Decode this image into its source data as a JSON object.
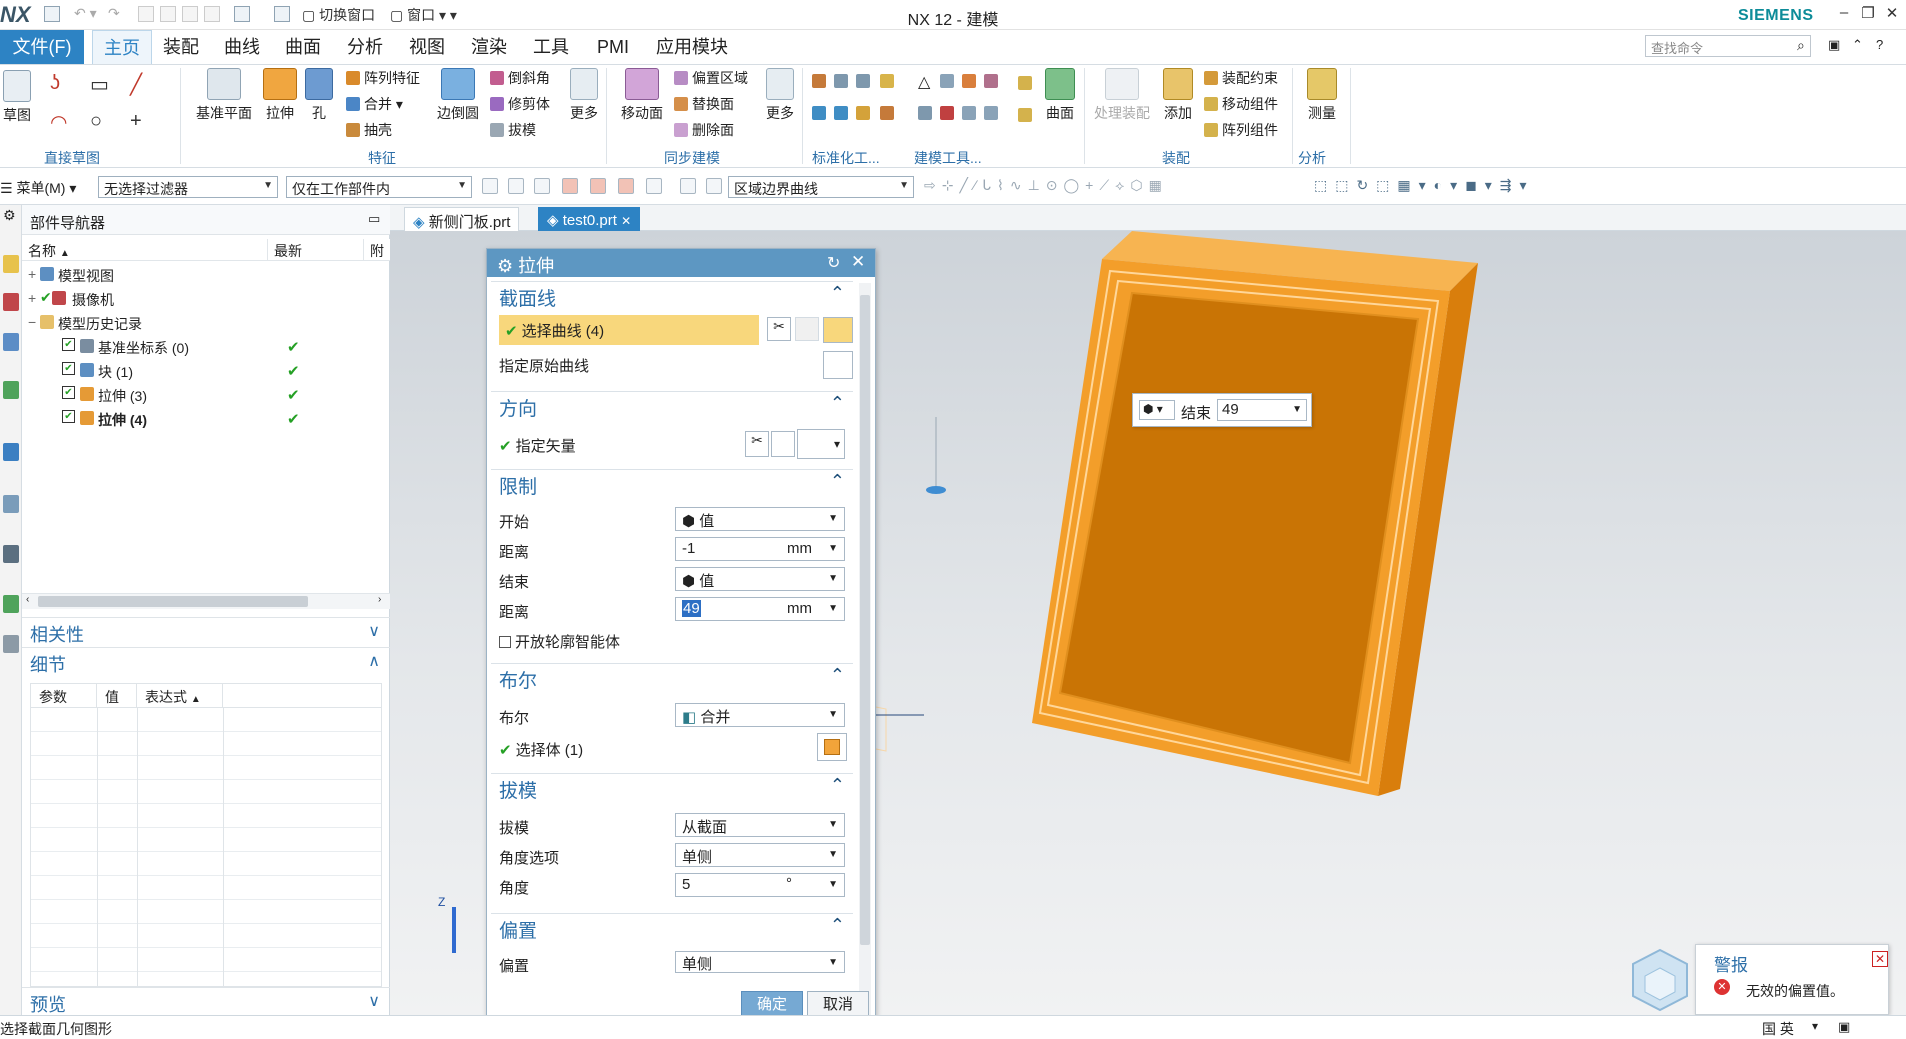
{
  "app": {
    "logo": "NX",
    "title": "NX 12 - 建模",
    "brand": "SIEMENS"
  },
  "quick_access": {
    "switch_window": "切换窗口",
    "window": "窗口"
  },
  "menu": {
    "file": "文件(F)",
    "tabs": [
      "主页",
      "装配",
      "曲线",
      "曲面",
      "分析",
      "视图",
      "渲染",
      "工具",
      "PMI",
      "应用模块"
    ]
  },
  "search": {
    "placeholder": "查找命令"
  },
  "ribbon": {
    "sketch": "草图",
    "direct_sketch": "直接草图",
    "datum_plane": "基准平面",
    "extrude": "拉伸",
    "hole": "孔",
    "pattern_feature": "阵列特征",
    "unite": "合并",
    "shell": "抽壳",
    "edge_blend": "边倒圆",
    "chamfer": "倒斜角",
    "trim_body": "修剪体",
    "draft": "拔模",
    "more": "更多",
    "feature_group": "特征",
    "move_face": "移动面",
    "offset_region": "偏置区域",
    "replace_face": "替换面",
    "delete_face": "删除面",
    "sync_group": "同步建模",
    "std_group": "标准化工...",
    "model_tools": "建模工具...",
    "surface": "曲面",
    "process_assembly": "处理装配",
    "add": "添加",
    "assembly_constraint": "装配约束",
    "move_component": "移动组件",
    "pattern_component": "阵列组件",
    "assembly_group": "装配",
    "measure": "测量",
    "analysis_group": "分析"
  },
  "selection_bar": {
    "menu": "菜单(M)",
    "filter": "无选择过滤器",
    "scope": "仅在工作部件内",
    "curve_rule": "区域边界曲线"
  },
  "navigator": {
    "title": "部件导航器",
    "columns": [
      "名称",
      "最新",
      "附"
    ],
    "rows": [
      {
        "label": "模型视图",
        "check": ""
      },
      {
        "label": "摄像机",
        "check": ""
      },
      {
        "label": "模型历史记录",
        "check": ""
      },
      {
        "label": "基准坐标系 (0)",
        "check": "✔"
      },
      {
        "label": "块 (1)",
        "check": "✔"
      },
      {
        "label": "拉伸 (3)",
        "check": "✔"
      },
      {
        "label": "拉伸 (4)",
        "check": "✔"
      }
    ],
    "sections": {
      "dependencies": "相关性",
      "details": "细节",
      "preview": "预览"
    },
    "details_columns": [
      "参数",
      "值",
      "表达式"
    ]
  },
  "doc_tabs": [
    "新侧门板.prt",
    "test0.prt"
  ],
  "dialog": {
    "title": "拉伸",
    "section": {
      "header": "截面线",
      "select_curve": "选择曲线 (4)",
      "specify_original": "指定原始曲线"
    },
    "direction": {
      "header": "方向",
      "specify_vector": "指定矢量"
    },
    "limits": {
      "header": "限制",
      "start_label": "开始",
      "start_value": "值",
      "dist1_label": "距离",
      "dist1_value": "-1",
      "end_label": "结束",
      "end_value": "值",
      "dist2_label": "距离",
      "dist2_value": "49",
      "unit": "mm",
      "open_profile": "开放轮廓智能体"
    },
    "boolean": {
      "header": "布尔",
      "label": "布尔",
      "value": "合并",
      "select_body": "选择体 (1)"
    },
    "draft": {
      "header": "拔模",
      "draft_label": "拔模",
      "draft_value": "从截面",
      "angle_option_label": "角度选项",
      "angle_option_value": "单侧",
      "angle_label": "角度",
      "angle_value": "5",
      "angle_unit": "°"
    },
    "offset": {
      "header": "偏置",
      "label": "偏置",
      "value": "单侧"
    },
    "ok": "确定",
    "cancel": "取消"
  },
  "viewport_label": {
    "label": "结束",
    "value": "49"
  },
  "warning": {
    "title": "警报",
    "message": "无效的偏置值。"
  },
  "status": {
    "prompt": "选择截面几何图形",
    "ime": "国 英"
  }
}
